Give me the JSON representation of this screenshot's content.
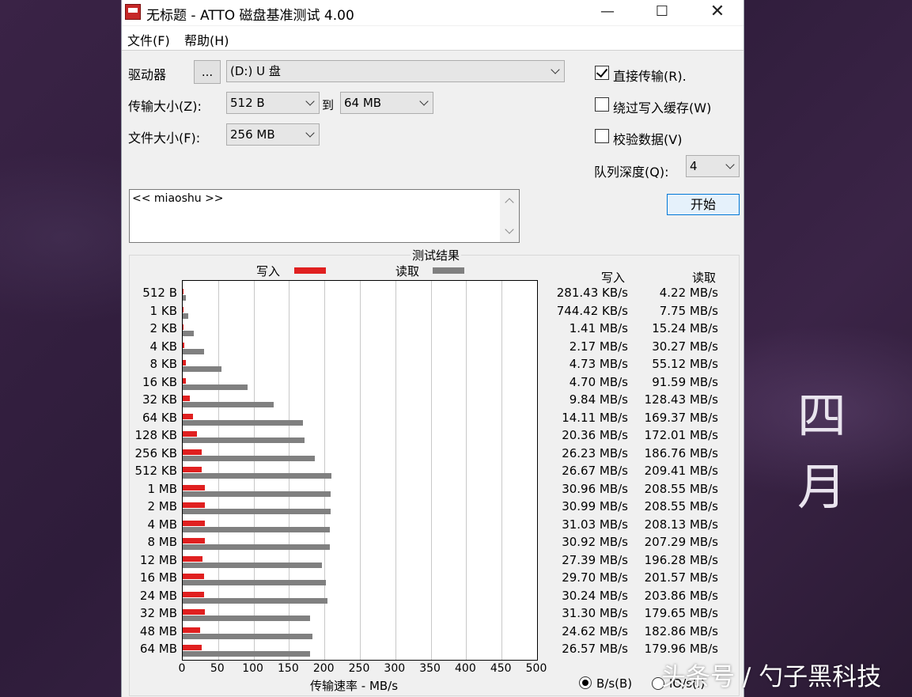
{
  "window": {
    "title": "无标题 - ATTO 磁盘基准测试 4.00"
  },
  "menu": {
    "file": "文件(F)",
    "help": "帮助(H)"
  },
  "controls": {
    "drive_label": "驱动器",
    "drive_browse": "...",
    "drive_value": "(D:) U 盘",
    "transfer_label": "传输大小(Z):",
    "transfer_from": "512 B",
    "transfer_to_label": "到",
    "transfer_to": "64 MB",
    "file_size_label": "文件大小(F):",
    "file_size": "256 MB",
    "direct_io_label": "直接传输(R).",
    "direct_io_checked": true,
    "bypass_cache_label": "绕过写入缓存(W)",
    "bypass_cache_checked": false,
    "verify_label": "校验数据(V)",
    "verify_checked": false,
    "queue_depth_label": "队列深度(Q):",
    "queue_depth": "4",
    "start_button": "开始",
    "description": "<< miaoshu >>"
  },
  "results": {
    "title": "测试结果",
    "legend_write": "写入",
    "legend_read": "读取",
    "col_write": "写入",
    "col_read": "读取",
    "axis_title": "传输速率 - MB/s",
    "unit_bs": "B/s(B)",
    "unit_io": "IO/s(I)",
    "unit_bs_selected": true,
    "rows": [
      {
        "size": "512 B",
        "write": "281.43 KB/s",
        "read": "4.22 MB/s"
      },
      {
        "size": "1 KB",
        "write": "744.42 KB/s",
        "read": "7.75 MB/s"
      },
      {
        "size": "2 KB",
        "write": "1.41 MB/s",
        "read": "15.24 MB/s"
      },
      {
        "size": "4 KB",
        "write": "2.17 MB/s",
        "read": "30.27 MB/s"
      },
      {
        "size": "8 KB",
        "write": "4.73 MB/s",
        "read": "55.12 MB/s"
      },
      {
        "size": "16 KB",
        "write": "4.70 MB/s",
        "read": "91.59 MB/s"
      },
      {
        "size": "32 KB",
        "write": "9.84 MB/s",
        "read": "128.43 MB/s"
      },
      {
        "size": "64 KB",
        "write": "14.11 MB/s",
        "read": "169.37 MB/s"
      },
      {
        "size": "128 KB",
        "write": "20.36 MB/s",
        "read": "172.01 MB/s"
      },
      {
        "size": "256 KB",
        "write": "26.23 MB/s",
        "read": "186.76 MB/s"
      },
      {
        "size": "512 KB",
        "write": "26.67 MB/s",
        "read": "209.41 MB/s"
      },
      {
        "size": "1 MB",
        "write": "30.96 MB/s",
        "read": "208.55 MB/s"
      },
      {
        "size": "2 MB",
        "write": "30.99 MB/s",
        "read": "208.55 MB/s"
      },
      {
        "size": "4 MB",
        "write": "31.03 MB/s",
        "read": "208.13 MB/s"
      },
      {
        "size": "8 MB",
        "write": "30.92 MB/s",
        "read": "207.29 MB/s"
      },
      {
        "size": "12 MB",
        "write": "27.39 MB/s",
        "read": "196.28 MB/s"
      },
      {
        "size": "16 MB",
        "write": "29.70 MB/s",
        "read": "201.57 MB/s"
      },
      {
        "size": "24 MB",
        "write": "30.24 MB/s",
        "read": "203.86 MB/s"
      },
      {
        "size": "32 MB",
        "write": "31.30 MB/s",
        "read": "179.65 MB/s"
      },
      {
        "size": "48 MB",
        "write": "24.62 MB/s",
        "read": "182.86 MB/s"
      },
      {
        "size": "64 MB",
        "write": "26.57 MB/s",
        "read": "179.96 MB/s"
      }
    ]
  },
  "chart_data": {
    "type": "bar",
    "orientation": "horizontal",
    "title": "测试结果",
    "xlabel": "传输速率 - MB/s",
    "xlim": [
      0,
      500
    ],
    "xticks": [
      "0",
      "50",
      "100",
      "150",
      "200",
      "250",
      "300",
      "350",
      "400",
      "450",
      "500"
    ],
    "categories": [
      "512 B",
      "1 KB",
      "2 KB",
      "4 KB",
      "8 KB",
      "16 KB",
      "32 KB",
      "64 KB",
      "128 KB",
      "256 KB",
      "512 KB",
      "1 MB",
      "2 MB",
      "4 MB",
      "8 MB",
      "12 MB",
      "16 MB",
      "24 MB",
      "32 MB",
      "48 MB",
      "64 MB"
    ],
    "series": [
      {
        "name": "写入",
        "color": "#e02020",
        "values": [
          0.27,
          0.73,
          1.41,
          2.17,
          4.73,
          4.7,
          9.84,
          14.11,
          20.36,
          26.23,
          26.67,
          30.96,
          30.99,
          31.03,
          30.92,
          27.39,
          29.7,
          30.24,
          31.3,
          24.62,
          26.57
        ]
      },
      {
        "name": "读取",
        "color": "#808080",
        "values": [
          4.22,
          7.75,
          15.24,
          30.27,
          55.12,
          91.59,
          128.43,
          169.37,
          172.01,
          186.76,
          209.41,
          208.55,
          208.55,
          208.13,
          207.29,
          196.28,
          201.57,
          203.86,
          179.65,
          182.86,
          179.96
        ]
      }
    ],
    "grid": true,
    "legend": "top"
  },
  "background": {
    "text": "四 月",
    "watermark": "头条号 / 勺子黑科技"
  }
}
